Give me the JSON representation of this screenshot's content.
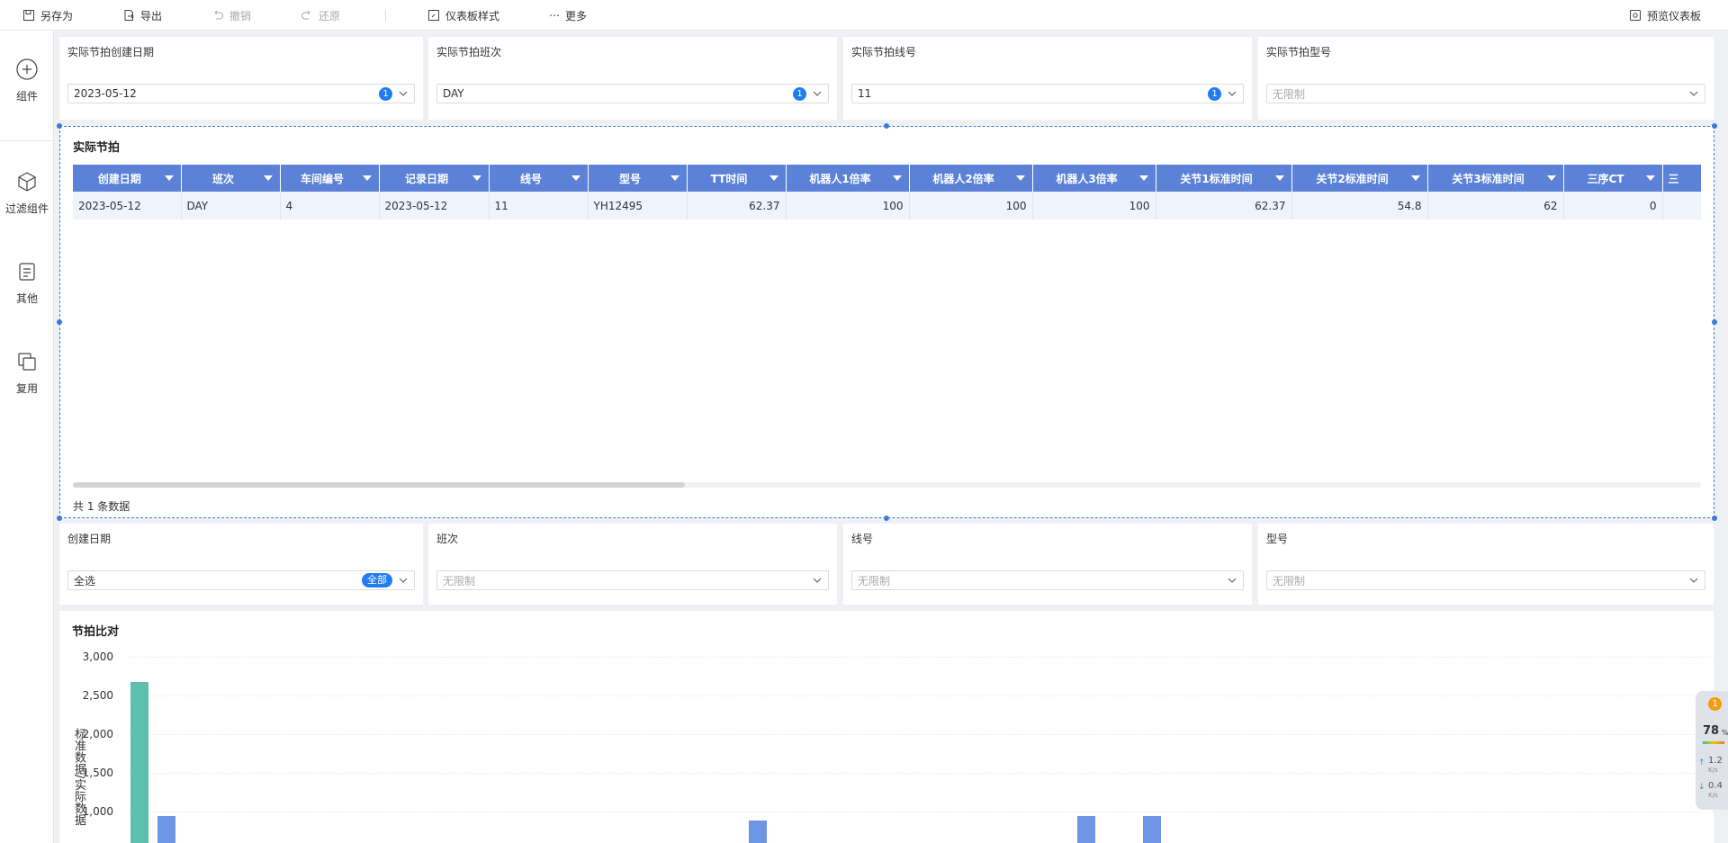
{
  "toolbar": {
    "save_as": "另存为",
    "export": "导出",
    "undo": "撤销",
    "redo": "还原",
    "dashboard_style": "仪表板样式",
    "more": "更多",
    "preview": "预览仪表板"
  },
  "sidebar": {
    "items": [
      {
        "label": "组件",
        "icon": "plus-circle-icon"
      },
      {
        "label": "过滤组件",
        "icon": "cube-icon"
      },
      {
        "label": "其他",
        "icon": "document-icon"
      },
      {
        "label": "复用",
        "icon": "copy-icon"
      }
    ]
  },
  "filters_top": [
    {
      "title": "实际节拍创建日期",
      "value": "2023-05-12",
      "count": "1"
    },
    {
      "title": "实际节拍班次",
      "value": "DAY",
      "count": "1"
    },
    {
      "title": "实际节拍线号",
      "value": "11",
      "count": "1"
    },
    {
      "title": "实际节拍型号",
      "placeholder": "无限制"
    }
  ],
  "table": {
    "title": "实际节拍",
    "columns": [
      "创建日期",
      "班次",
      "车间编号",
      "记录日期",
      "线号",
      "型号",
      "TT时间",
      "机器人1倍率",
      "机器人2倍率",
      "机器人3倍率",
      "关节1标准时间",
      "关节2标准时间",
      "关节3标准时间",
      "三序CT",
      "三"
    ],
    "rows": [
      [
        "2023-05-12",
        "DAY",
        "4",
        "2023-05-12",
        "11",
        "YH12495",
        "62.37",
        "100",
        "100",
        "100",
        "62.37",
        "54.8",
        "62",
        "0",
        ""
      ]
    ],
    "footer": "共 1 条数据"
  },
  "filters_bottom": [
    {
      "title": "创建日期",
      "value": "全选",
      "tag": "全部"
    },
    {
      "title": "班次",
      "placeholder": "无限制"
    },
    {
      "title": "线号",
      "placeholder": "无限制"
    },
    {
      "title": "型号",
      "placeholder": "无限制"
    }
  ],
  "chart_data": {
    "type": "bar",
    "title": "节拍比对",
    "ylabel": "标准数据/实际数据",
    "yticks": [
      "3,000",
      "2,500",
      "2,000",
      "1,500",
      "1,000"
    ],
    "ylim": [
      700,
      3000
    ],
    "colors": {
      "series1": "#5fbfae",
      "series2": "#6f95e6"
    },
    "series": [
      {
        "values": [
          2680,
          null,
          null,
          null,
          null,
          null,
          null,
          null,
          null,
          null,
          null,
          null,
          null,
          null,
          null,
          null,
          null,
          null,
          null,
          null,
          null,
          null,
          null,
          null,
          null,
          null,
          null,
          null,
          null,
          null,
          null,
          null,
          null,
          null,
          null,
          null,
          null,
          null,
          null,
          null,
          null,
          null,
          null,
          null,
          null,
          null,
          null,
          null,
          null,
          null,
          null,
          null,
          null,
          null,
          null,
          null,
          null,
          null,
          null,
          null,
          null,
          null,
          null,
          null,
          null,
          null,
          null,
          null,
          null,
          null,
          null,
          null,
          null,
          null,
          null,
          null,
          null,
          null,
          null,
          null,
          null,
          null,
          null,
          null,
          null,
          null,
          null,
          null,
          null,
          null,
          null,
          null,
          null,
          null,
          null,
          null,
          null,
          null,
          null,
          null
        ]
      },
      {
        "values": [
          940,
          null,
          null,
          null,
          null,
          null,
          null,
          null,
          null,
          null,
          null,
          null,
          null,
          null,
          null,
          null,
          null,
          null,
          null,
          null,
          null,
          null,
          null,
          null,
          null,
          null,
          null,
          null,
          null,
          null,
          null,
          null,
          null,
          null,
          null,
          null,
          null,
          null,
          null,
          null,
          null,
          null,
          null,
          null,
          null,
          null,
          null,
          null,
          null,
          null,
          null,
          null,
          null,
          null,
          null,
          null,
          null,
          null,
          null,
          null,
          null,
          null,
          null,
          null,
          null,
          null,
          null,
          null,
          null,
          null,
          null,
          null,
          null,
          null,
          null,
          null,
          null,
          null,
          null,
          null,
          null,
          null,
          null,
          null,
          null,
          null,
          null,
          null,
          null,
          null,
          null,
          null,
          null,
          null,
          null,
          null,
          null,
          null,
          null,
          null
        ]
      }
    ],
    "extra_bars": [
      {
        "slot": 0,
        "value": 880
      },
      {
        "slot": 1,
        "value": 940
      },
      {
        "slot": 2,
        "value": 940
      }
    ]
  },
  "widget": {
    "alert": "1",
    "percent": "78",
    "pct_unit": "%",
    "up_speed": "1.2",
    "down_speed": "0.4",
    "unit": "K/s"
  }
}
